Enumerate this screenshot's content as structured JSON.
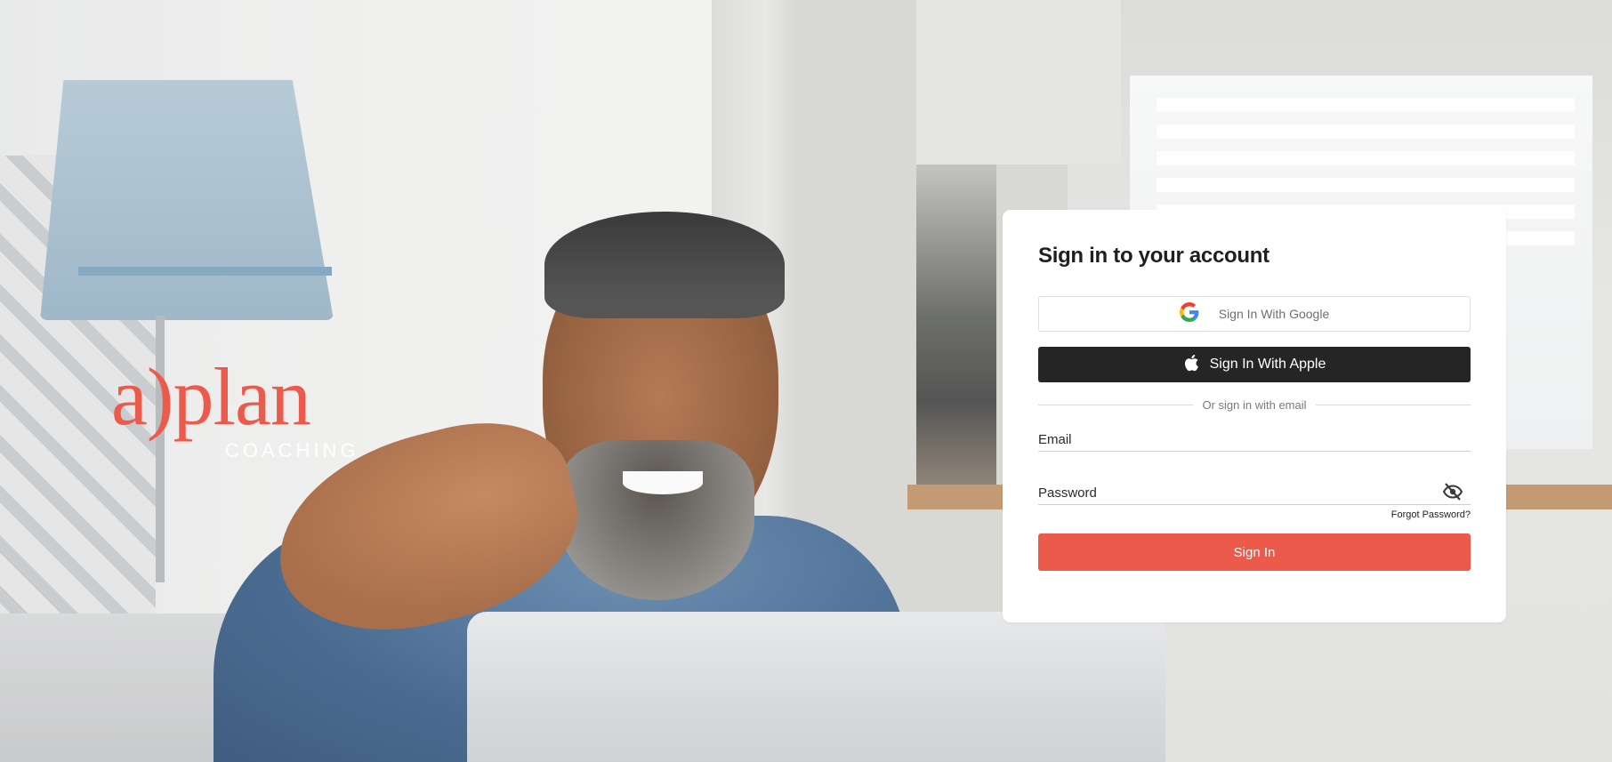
{
  "logo": {
    "mark": "a)plan",
    "sub": "COACHING"
  },
  "card": {
    "title": "Sign in to your account",
    "google_label": "Sign In With Google",
    "apple_label": "Sign In With Apple",
    "divider_text": "Or sign in with email",
    "email_label": "Email",
    "password_label": "Password",
    "forgot_label": "Forgot Password?",
    "signin_label": "Sign In"
  },
  "colors": {
    "accent": "#ec5a4b",
    "apple_button": "#252525"
  },
  "icons": {
    "google": "google-icon",
    "apple": "apple-icon",
    "password_toggle": "eye-off-icon"
  }
}
